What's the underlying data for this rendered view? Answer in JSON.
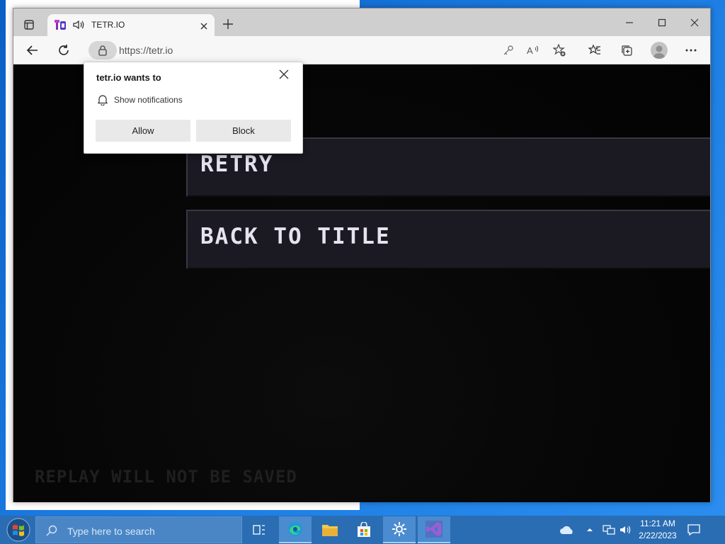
{
  "browser": {
    "tab_title": "TETR.IO",
    "url": "https://tetr.io",
    "favicon": "tetrio-favicon",
    "icons": {
      "tab_actions": "tab-actions-icon",
      "audio": "speaker-icon",
      "close_tab": "close-icon",
      "new_tab": "plus-icon",
      "back": "arrow-left-icon",
      "refresh": "refresh-icon",
      "lock": "lock-icon",
      "key": "key-icon",
      "read_aloud": "read-aloud-icon",
      "add_favorite": "star-add-icon",
      "favorites": "favorites-icon",
      "collections": "collections-icon",
      "profile": "profile-icon",
      "more": "more-icon",
      "minimize": "minimize-icon",
      "maximize": "maximize-icon",
      "close_window": "close-window-icon"
    }
  },
  "notification_popup": {
    "title": "tetr.io wants to",
    "permission": "Show notifications",
    "allow_label": "Allow",
    "block_label": "Block"
  },
  "game": {
    "retry_label": "RETRY",
    "back_to_title_label": "BACK TO TITLE",
    "replay_notice": "REPLAY WILL NOT BE SAVED",
    "button_bg": "#1b1922",
    "button_text_color": "#e6e3ee"
  },
  "taskbar": {
    "search_placeholder": "Type here to search",
    "apps": [
      "task-view",
      "edge",
      "file-explorer",
      "microsoft-store",
      "settings",
      "visual-studio"
    ],
    "time": "11:21 AM",
    "date": "2/22/2023",
    "tray": [
      "onedrive-icon",
      "chevron-up-icon",
      "network-icon",
      "volume-icon",
      "notification-icon"
    ],
    "accent": "#2a6db3"
  }
}
